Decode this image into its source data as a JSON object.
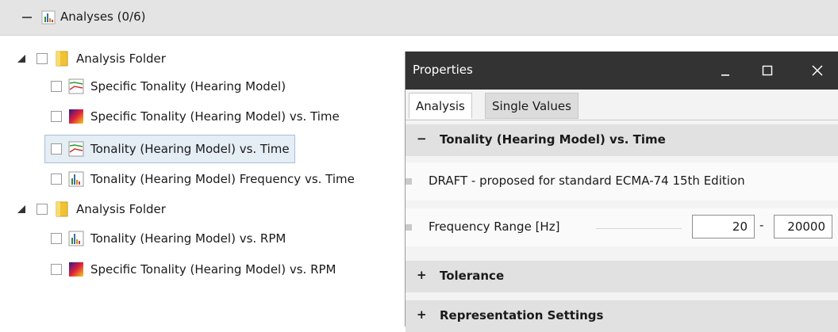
{
  "analyses": {
    "title": "Analyses (0/6)"
  },
  "tree": [
    {
      "type": "folder",
      "label": "Analysis Folder"
    },
    {
      "type": "item",
      "icon": "line-graph-icon",
      "label": "Specific Tonality (Hearing Model)"
    },
    {
      "type": "item",
      "icon": "spectrogram-icon",
      "label": "Specific Tonality (Hearing Model) vs. Time"
    },
    {
      "type": "item",
      "icon": "line-graph-icon",
      "label": "Tonality (Hearing Model) vs. Time",
      "selected": true
    },
    {
      "type": "item",
      "icon": "bar-chart-icon",
      "label": "Tonality (Hearing Model) Frequency vs. Time"
    },
    {
      "type": "folder",
      "label": "Analysis Folder"
    },
    {
      "type": "item",
      "icon": "bar-chart-icon",
      "label": "Tonality (Hearing Model) vs. RPM"
    },
    {
      "type": "item",
      "icon": "spectrogram-icon",
      "label": "Specific Tonality (Hearing Model) vs. RPM"
    }
  ],
  "properties": {
    "title": "Properties",
    "tabs": [
      "Analysis",
      "Single Values"
    ],
    "section_main": "Tonality (Hearing Model) vs. Time",
    "draft_text": "DRAFT - proposed for standard ECMA-74 15th Edition",
    "freq_label": "Frequency Range [Hz]",
    "freq_from": "20",
    "freq_sep": "-",
    "freq_to": "20000",
    "section_tolerance": "Tolerance",
    "section_representation": "Representation Settings",
    "collapse_sign": "−",
    "expand_sign": "+"
  }
}
